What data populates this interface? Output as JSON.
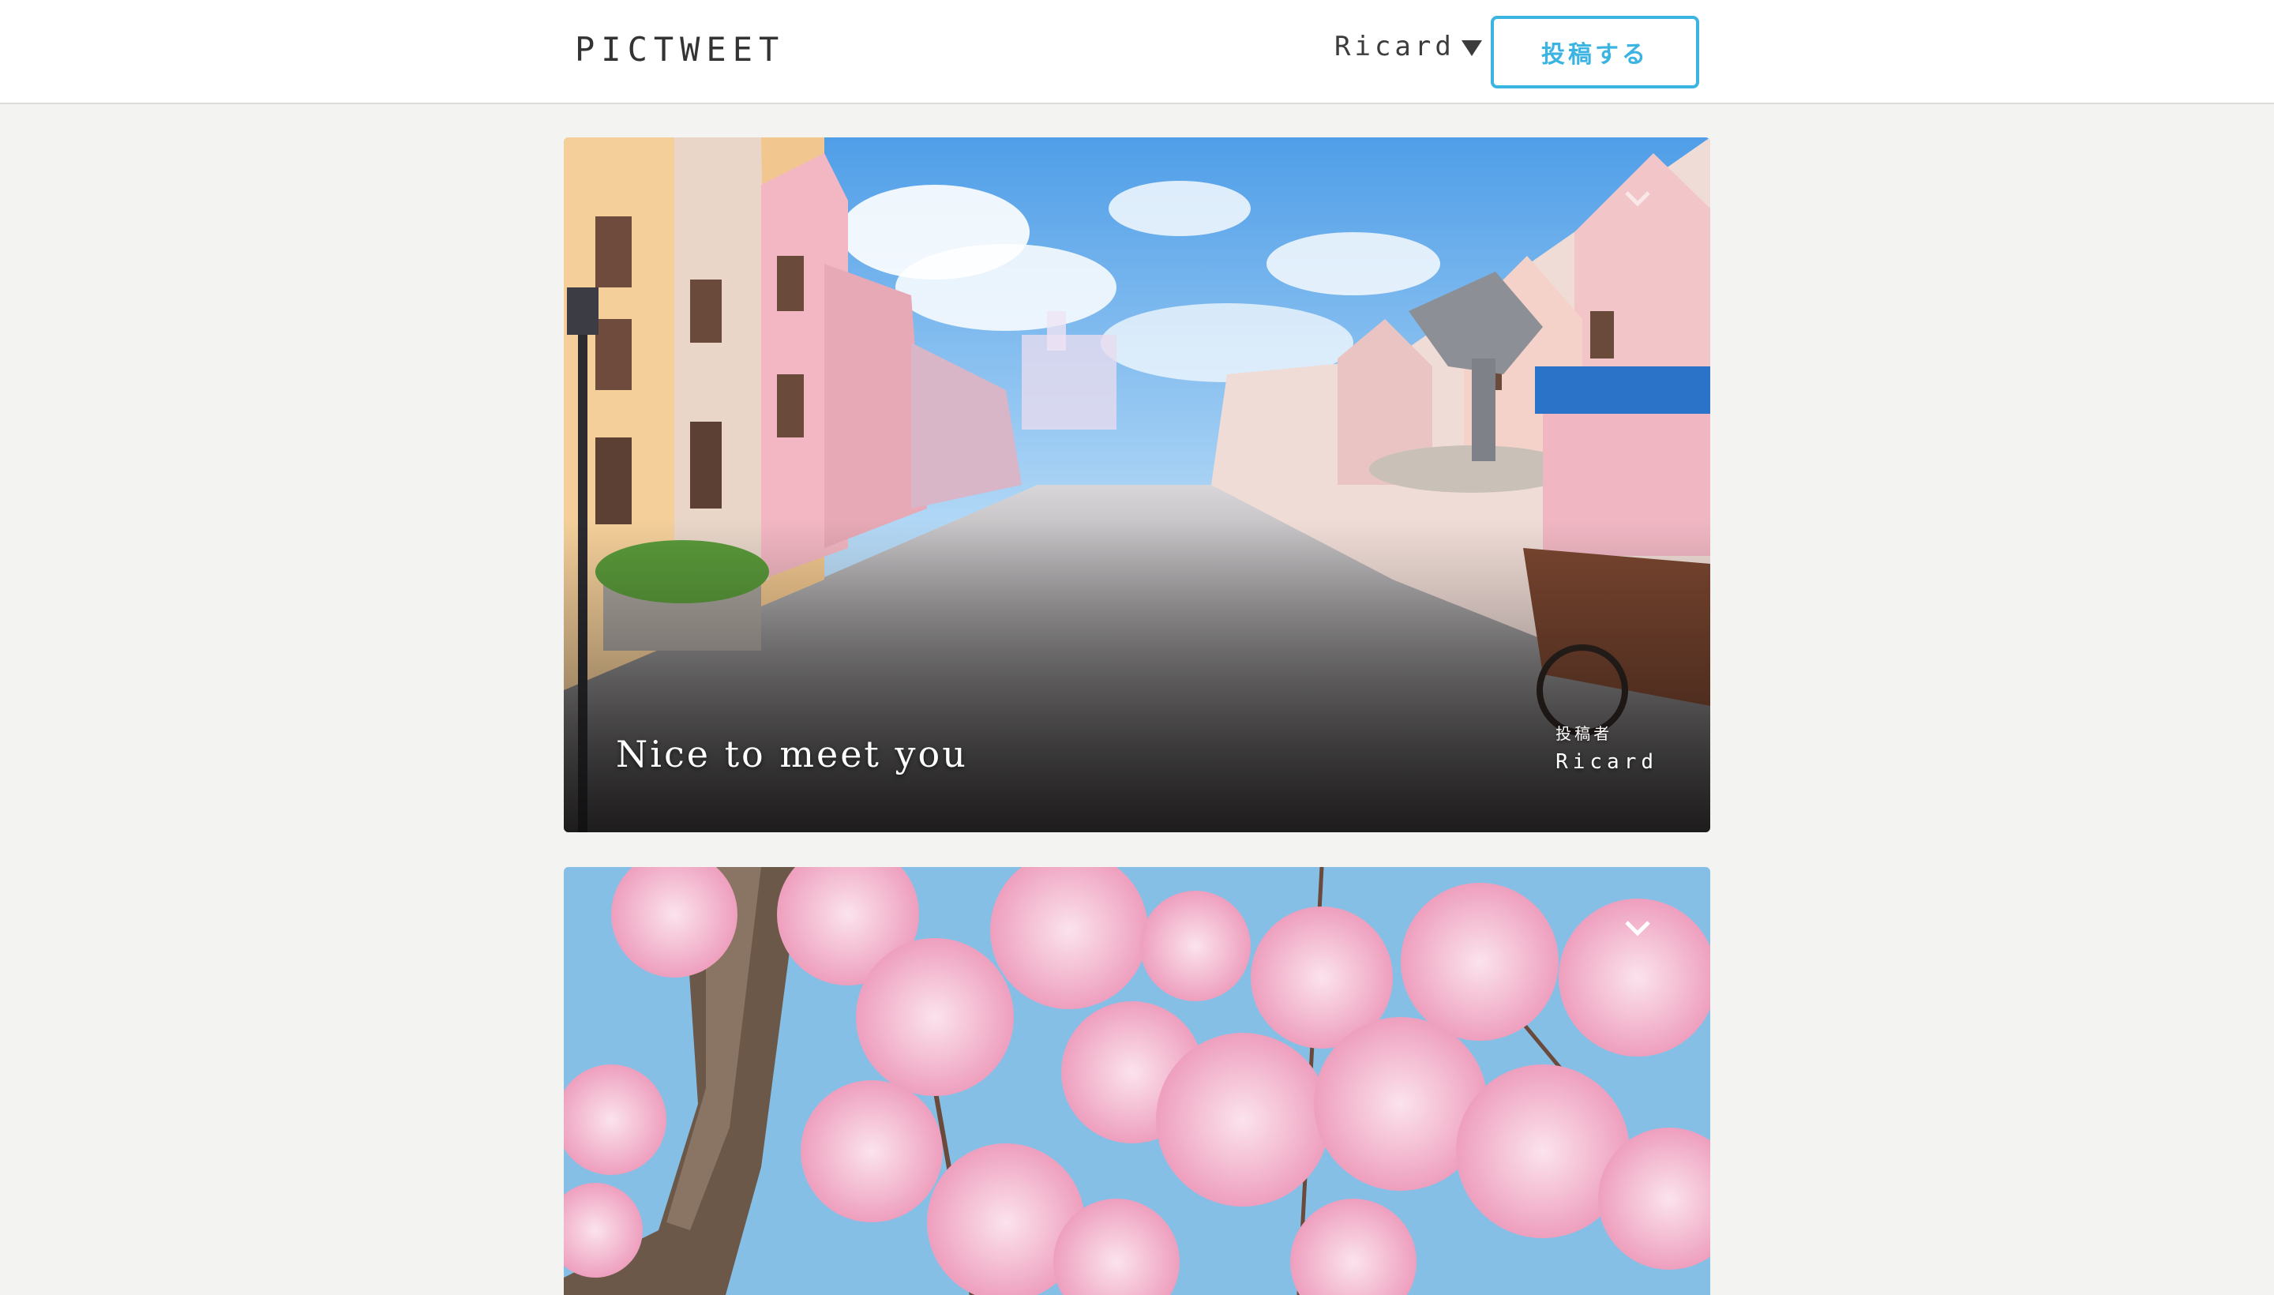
{
  "header": {
    "logo": "PICTWEET",
    "user_name": "Ricard",
    "post_button_label": "投稿する"
  },
  "posts": [
    {
      "title": "Nice to meet you",
      "author_label": "投稿者",
      "author_name": "Ricard",
      "image": "anime-european-town-street"
    },
    {
      "title": "",
      "author_label": "",
      "author_name": "",
      "image": "cherry-blossoms"
    }
  ],
  "colors": {
    "accent": "#3cb4e2",
    "background": "#f3f3f1",
    "header_bg": "#ffffff"
  }
}
